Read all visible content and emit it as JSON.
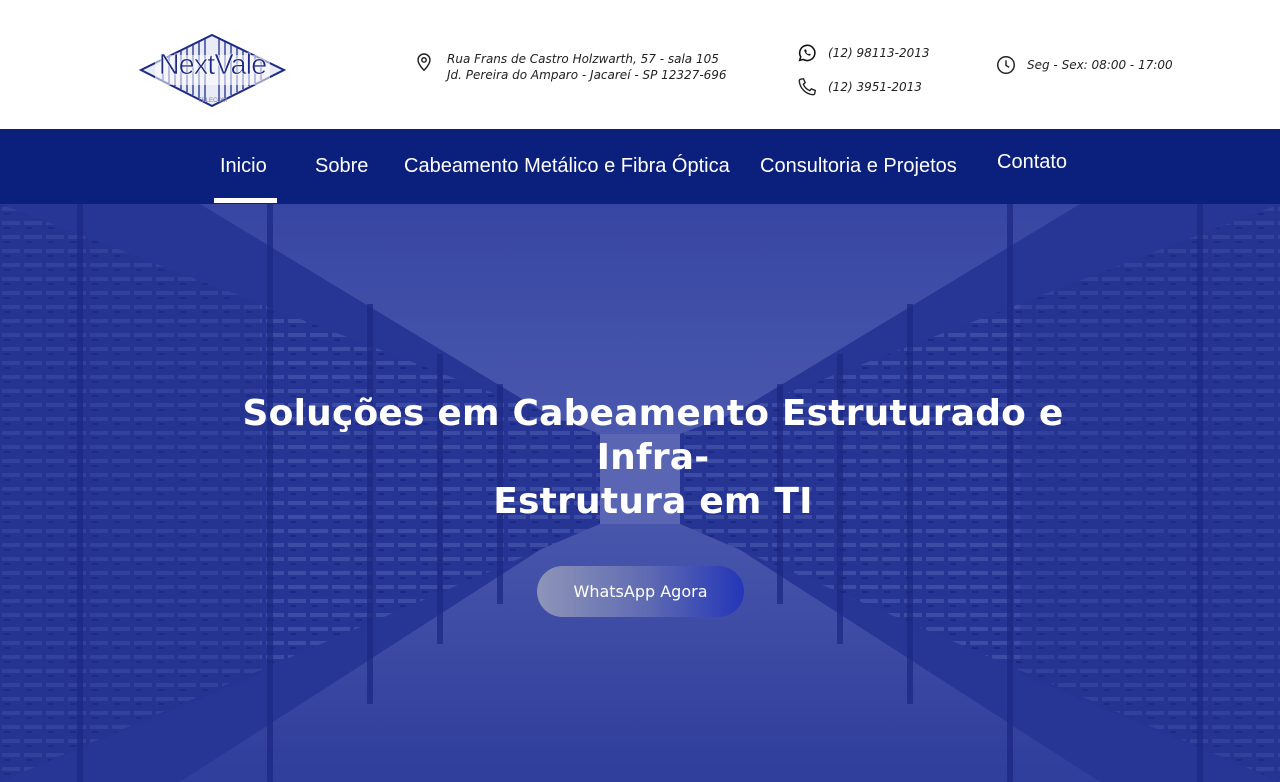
{
  "header": {
    "logo": {
      "name": "NextVale",
      "tagline": "TELECOM"
    },
    "address": {
      "icon": "map-pin-icon",
      "line1": "Rua Frans de Castro Holzwarth, 57 - sala 105",
      "line2": "Jd. Pereira do Amparo - Jacareí - SP 12327-696"
    },
    "whatsapp": {
      "icon": "whatsapp-icon",
      "number": "(12) 98113-2013"
    },
    "phone": {
      "icon": "phone-icon",
      "number": "(12) 3951-2013"
    },
    "hours": {
      "icon": "clock-icon",
      "text": "Seg - Sex: 08:00 - 17:00"
    }
  },
  "nav": {
    "active": "Inicio",
    "items": [
      {
        "label": "Inicio"
      },
      {
        "label": "Sobre"
      },
      {
        "label": "Cabeamento Metálico e Fibra Óptica"
      },
      {
        "label": "Consultoria e Projetos"
      },
      {
        "label": "Contato"
      }
    ]
  },
  "hero": {
    "title_line1": "Soluções em Cabeamento Estruturado e Infra-",
    "title_line2": "Estrutura em TI",
    "cta_label": "WhatsApp Agora"
  },
  "colors": {
    "nav_background": "#0b1f7c",
    "hero_overlay": "#1e2c8c",
    "text_white": "#ffffff",
    "logo_blue": "#1c2a86"
  }
}
